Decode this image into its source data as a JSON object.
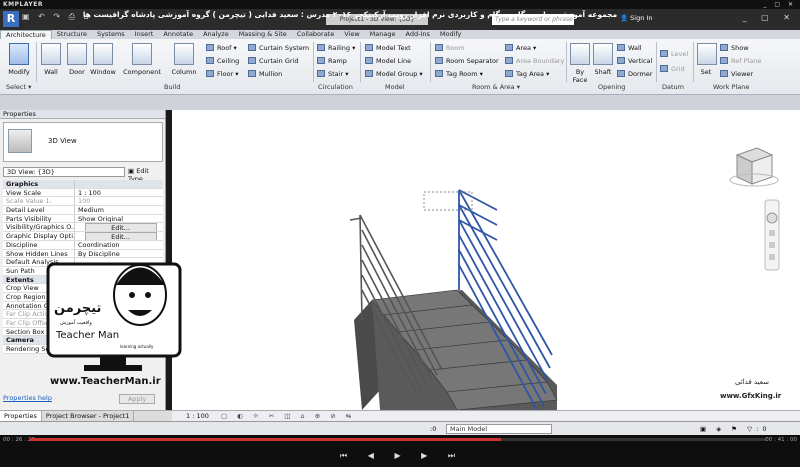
{
  "player": {
    "logo": "KMPLAYER",
    "controls": "_ ▢ ✕",
    "time_elapsed": "00 : 26 : 28",
    "time_total": "00 : 41 : 00",
    "progress": 0.64
  },
  "titlebar": {
    "overlay_text": "مجموعه آموزشی جامع ، گام به گام و کاربردی نرم افزار رویت آرکیتکچر ۲۰۱۶   مدرس : سعید فدایی ( تیچرمن ) گروه آموزشی پادشاه گرافیست ها",
    "project_title": "Project1 - 3D View: {3D}",
    "search_placeholder": "Type a keyword or phrase",
    "sign_in": "Sign In"
  },
  "tabs": [
    "Architecture",
    "Structure",
    "Systems",
    "Insert",
    "Annotate",
    "Analyze",
    "Massing & Site",
    "Collaborate",
    "View",
    "Manage",
    "Add-Ins",
    "Modify"
  ],
  "ribbon": {
    "modify": "Modify",
    "select": "Select ▾",
    "build_big": [
      "Wall",
      "Door",
      "Window",
      "Component",
      "Column"
    ],
    "build_small": [
      "Roof ▾",
      "Ceiling",
      "Floor ▾",
      "Curtain System",
      "Curtain Grid",
      "Mullion"
    ],
    "build": "Build",
    "circulation_items": [
      "Railing ▾",
      "Ramp",
      "Stair ▾"
    ],
    "circulation": "Circulation",
    "model_items": [
      "Model Text",
      "Model Line",
      "Model Group ▾"
    ],
    "model": "Model",
    "room_items": [
      "Room",
      "Room Separator",
      "Tag Room ▾",
      "Area ▾",
      "Area Boundary",
      "Tag Area ▾"
    ],
    "room_area": "Room & Area ▾",
    "opening_big": [
      "By Face",
      "Shaft"
    ],
    "opening_small": [
      "Wall",
      "Vertical",
      "Dormer"
    ],
    "opening": "Opening",
    "datum_items": [
      "Level",
      "Grid"
    ],
    "datum": "Datum",
    "work_big": "Set",
    "work_small": [
      "Show",
      "Ref  Plane",
      "Viewer"
    ],
    "workplane": "Work Plane"
  },
  "properties": {
    "header": "Properties",
    "type_name": "3D View",
    "selector": "3D View: {3D}",
    "edit_type": "Edit Type",
    "rows": [
      {
        "k": "Graphics",
        "v": "",
        "cls": "sec"
      },
      {
        "k": "View Scale",
        "v": "1 : 100"
      },
      {
        "k": "Scale Value    1:",
        "v": "100",
        "cls": "dim"
      },
      {
        "k": "Detail Level",
        "v": "Medium"
      },
      {
        "k": "Parts Visibility",
        "v": "Show Original"
      },
      {
        "k": "Visibility/Graphics O...",
        "v": "Edit...",
        "btn": true
      },
      {
        "k": "Graphic Display Opti...",
        "v": "Edit...",
        "btn": true
      },
      {
        "k": "Discipline",
        "v": "Coordination"
      },
      {
        "k": "Show Hidden Lines",
        "v": "By Discipline"
      },
      {
        "k": "Default Analysis...",
        "v": ""
      },
      {
        "k": "Sun Path",
        "v": ""
      },
      {
        "k": "Extents",
        "v": "",
        "cls": "sec"
      },
      {
        "k": "Crop View",
        "v": ""
      },
      {
        "k": "Crop Region Visible",
        "v": ""
      },
      {
        "k": "Annotation Crop",
        "v": ""
      },
      {
        "k": "Far Clip Active",
        "v": "",
        "cls": "dim"
      },
      {
        "k": "Far Clip Offset",
        "v": "",
        "cls": "dim"
      },
      {
        "k": "Section Box",
        "v": ""
      },
      {
        "k": "Camera",
        "v": "",
        "cls": "sec"
      },
      {
        "k": "Rendering Settings",
        "v": "Edit...",
        "btn": true
      }
    ],
    "help": "Properties help",
    "apply": "Apply",
    "tabs": [
      "Properties",
      "Project Browser - Project1"
    ]
  },
  "viewcontrol": {
    "scale": "1 : 100"
  },
  "status": {
    "zero": ":0",
    "main_model": "Main Model"
  },
  "watermark": {
    "url": "www.TeacherMan.ir",
    "logo_fa": "تیچرمن",
    "logo_sub": "واقعیت آموزش",
    "logo_en": "Teacher Man",
    "logo_en_sub": "learning actually",
    "gfx_fa": "سعید فدائی",
    "gfx_url": "www.GfxKing.ir"
  },
  "colors": {
    "railing_selected": "#2f55a8",
    "railing": "#555555",
    "stair": "#6a6a6a"
  }
}
